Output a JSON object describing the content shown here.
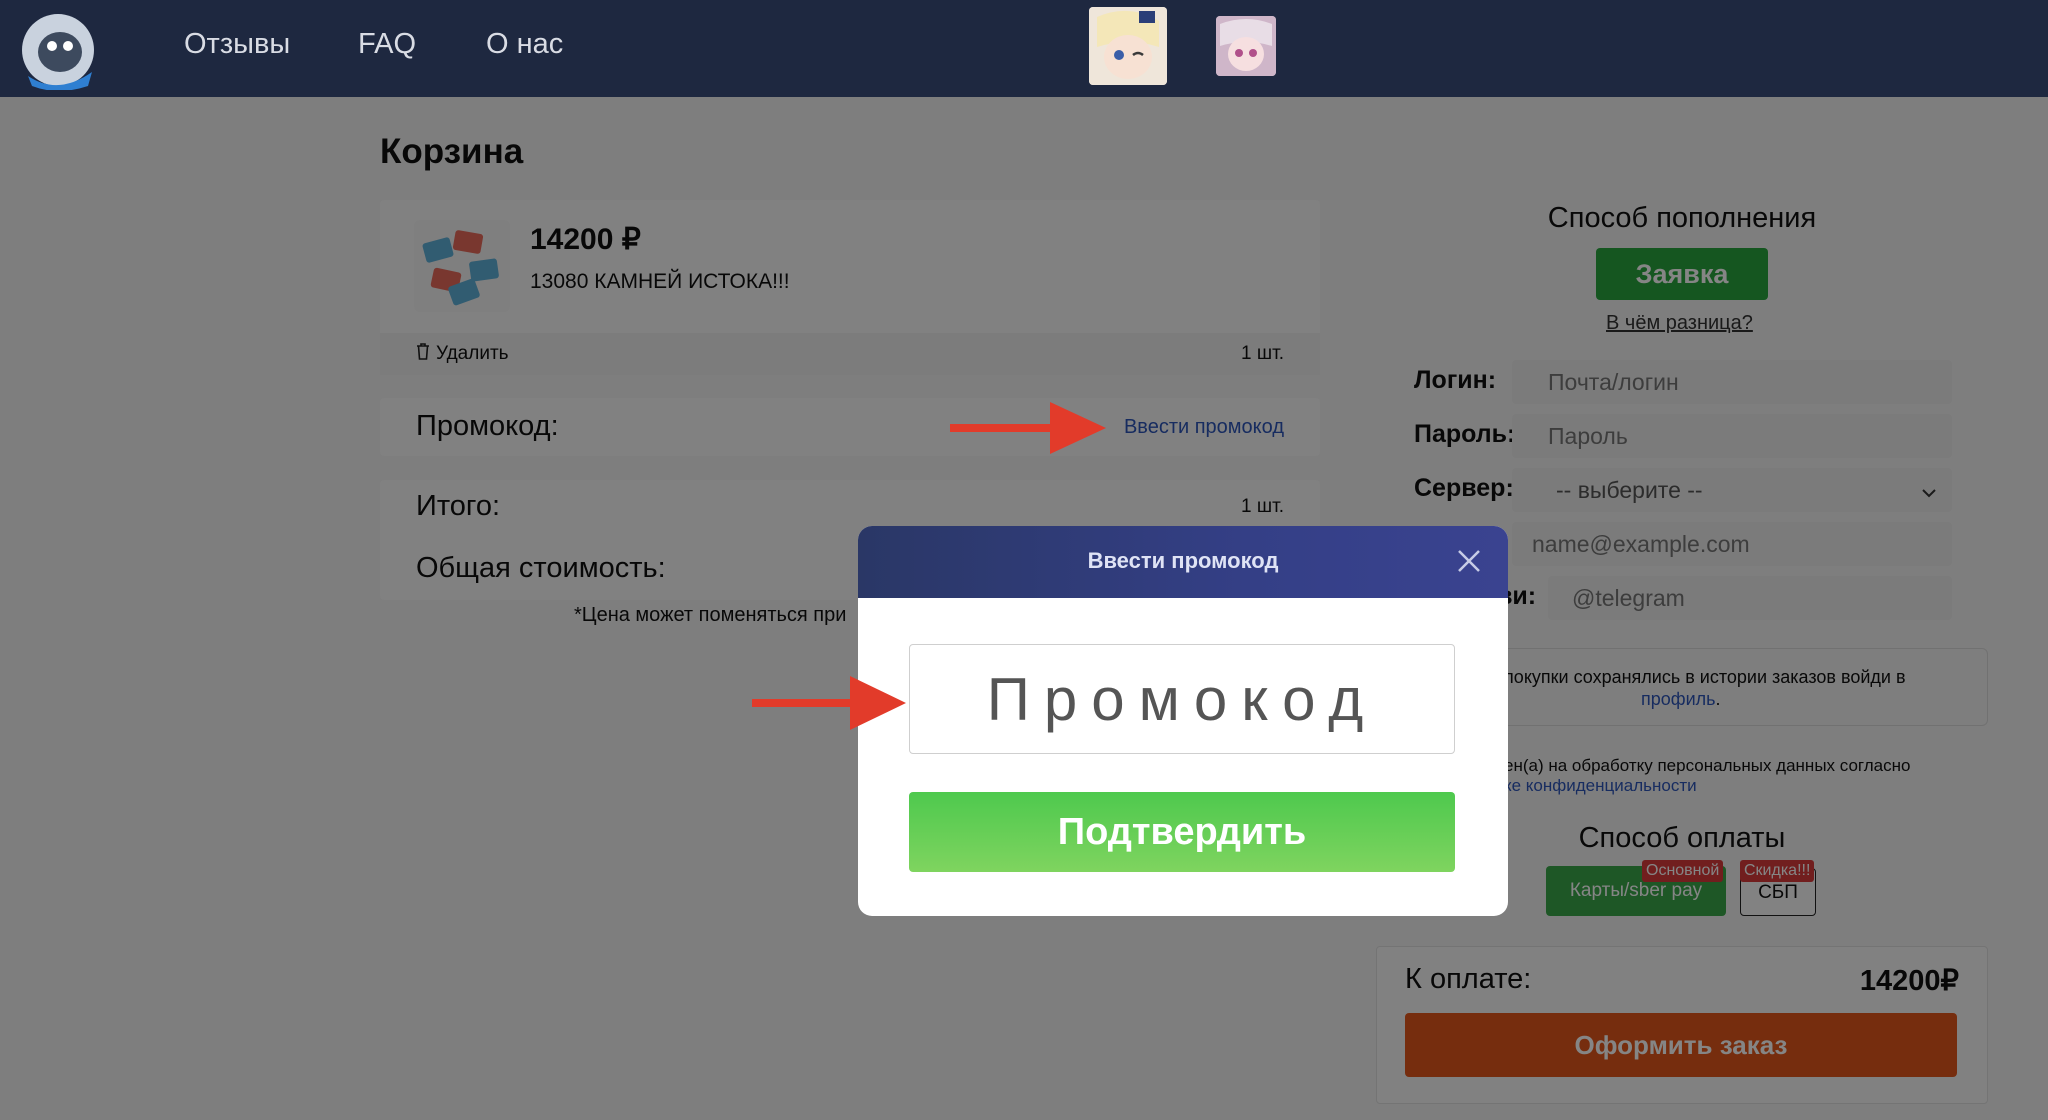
{
  "header": {
    "nav": [
      "Отзывы",
      "FAQ",
      "О нас"
    ]
  },
  "cart": {
    "title": "Корзина",
    "item": {
      "price": "14200 ₽",
      "name": "13080 КАМНЕЙ ИСТОКА!!!",
      "delete": "Удалить",
      "qty": "1 шт."
    },
    "promo_label": "Промокод:",
    "promo_link": "Ввести промокод",
    "total_label": "Итого:",
    "total_qty": "1 шт.",
    "cost_label": "Общая стоимость:",
    "note": "*Цена может поменяться при"
  },
  "sidebar": {
    "topup_title": "Способ пополнения",
    "topup_button": "Заявка",
    "diff_link": "В чём разница?",
    "login_label": "Логин:",
    "login_placeholder": "Почта/логин",
    "password_label": "Пароль:",
    "password_placeholder": "Пароль",
    "server_label": "Сервер:",
    "server_value": "-- выберите --",
    "email_placeholder": "name@example.com",
    "contact_label_partial": "зи:",
    "contact_placeholder": "@telegram",
    "info_text": "и покупки сохранялись в истории заказов войди в",
    "info_link": "профиль",
    "info_dot": ".",
    "consent_text": "ен(а) на обработку персональных данных согласно",
    "consent_link": "ке конфиденциальности",
    "payment_title": "Способ оплаты",
    "pay_option_1": "Карты/sber pay",
    "pay_badge_1": "Основной",
    "pay_option_2": "СБП",
    "pay_badge_2": "Скидка!!!",
    "to_pay_label": "К оплате:",
    "to_pay_amount": "14200₽",
    "order_button": "Оформить заказ"
  },
  "modal": {
    "title": "Ввести промокод",
    "input_placeholder": "Промокод",
    "confirm_button": "Подтвердить"
  },
  "colors": {
    "header_bg": "#1e2840",
    "modal_header": "#343f86",
    "confirm_green": "#5ccc55",
    "order_orange": "#e2571c",
    "arrow_red": "#e23b2a",
    "link_blue": "#2d55b8"
  }
}
